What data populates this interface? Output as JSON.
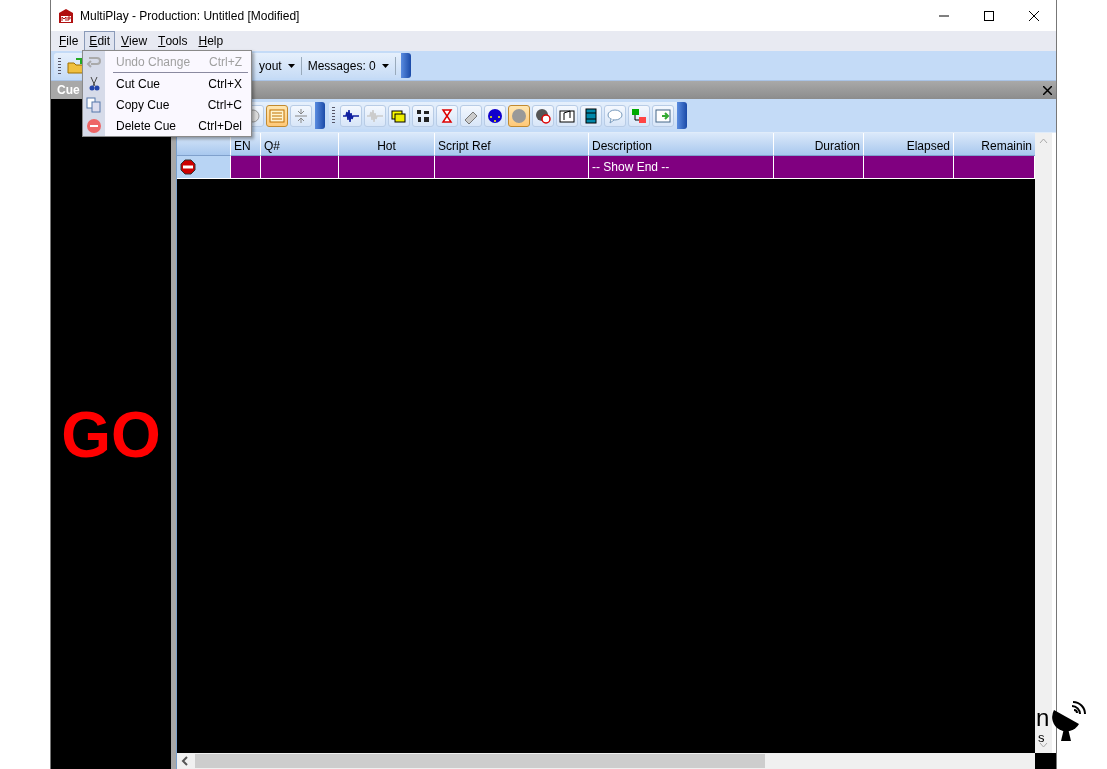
{
  "window": {
    "title": "MultiPlay - Production: Untitled [Modified]"
  },
  "menus": [
    {
      "label": "File",
      "selected": false
    },
    {
      "label": "Edit",
      "selected": true
    },
    {
      "label": "View",
      "selected": false
    },
    {
      "label": "Tools",
      "selected": false
    },
    {
      "label": "Help",
      "selected": false
    }
  ],
  "edit_menu": [
    {
      "kind": "item",
      "label": "Undo Change",
      "shortcut": "Ctrl+Z",
      "disabled": true
    },
    {
      "kind": "separator"
    },
    {
      "kind": "item",
      "label": "Cut Cue",
      "shortcut": "Ctrl+X",
      "disabled": false
    },
    {
      "kind": "item",
      "label": "Copy Cue",
      "shortcut": "Ctrl+C",
      "disabled": false
    },
    {
      "kind": "item",
      "label": "Delete Cue",
      "shortcut": "Ctrl+Del",
      "disabled": false
    }
  ],
  "main_toolbar": {
    "layout_button": "yout",
    "messages_button": "Messages: 0"
  },
  "cue_panel": {
    "title": "Cue",
    "go_label": "GO"
  },
  "cue_toolbar": {
    "view_buttons": [
      {
        "selected": false
      },
      {
        "selected": true
      },
      {
        "selected": false
      }
    ],
    "cue_types": [
      {
        "selected": false
      },
      {
        "selected": false
      },
      {
        "selected": false
      },
      {
        "selected": false
      },
      {
        "selected": false
      },
      {
        "selected": false
      },
      {
        "selected": false
      },
      {
        "selected": true
      },
      {
        "selected": false
      },
      {
        "selected": false
      },
      {
        "selected": false
      },
      {
        "selected": false
      },
      {
        "selected": false
      },
      {
        "selected": false
      }
    ]
  },
  "table": {
    "columns": [
      "EN",
      "Q#",
      "Hot",
      "Script Ref",
      "Description",
      "Duration",
      "Elapsed",
      "Remainin"
    ],
    "rows": [
      {
        "kind": "end",
        "description": "-- Show End --"
      }
    ]
  },
  "background_fragments": [
    "n",
    "s"
  ]
}
